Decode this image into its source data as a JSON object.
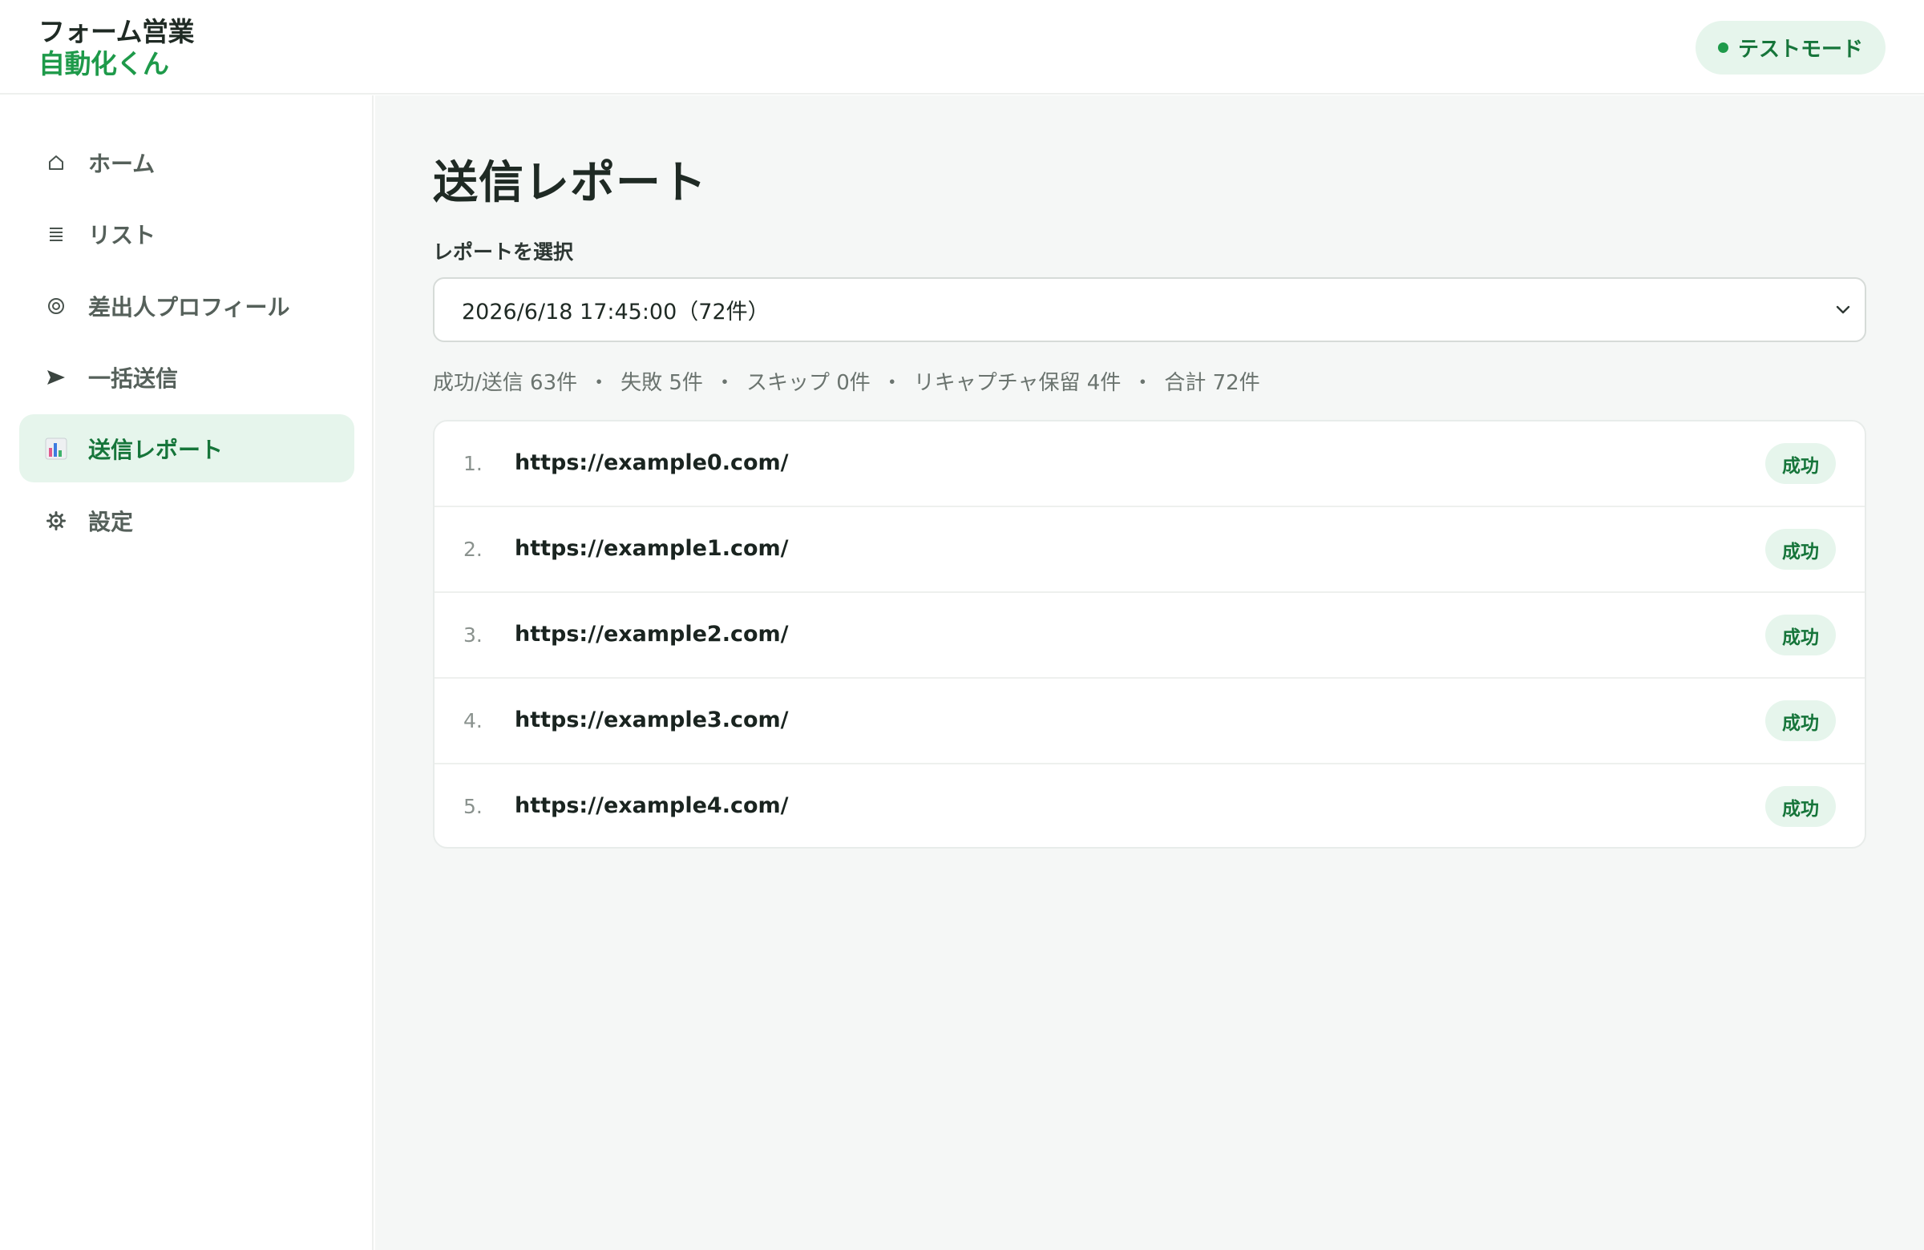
{
  "header": {
    "logo_line1": "フォーム営業",
    "logo_line2": "自動化くん",
    "mode_badge": "テストモード"
  },
  "sidebar": {
    "items": [
      {
        "label": "ホーム",
        "icon": "home-icon"
      },
      {
        "label": "リスト",
        "icon": "list-icon"
      },
      {
        "label": "差出人プロフィール",
        "icon": "profile-icon"
      },
      {
        "label": "一括送信",
        "icon": "send-icon"
      },
      {
        "label": "送信レポート",
        "icon": "chart-icon",
        "active": true
      },
      {
        "label": "設定",
        "icon": "gear-icon"
      }
    ]
  },
  "main": {
    "title": "送信レポート",
    "select_label": "レポートを選択",
    "selected_report": "2026/6/18 17:45:00（72件）",
    "summary": {
      "sent": "成功/送信 63件",
      "failed": "失敗 5件",
      "skipped": "スキップ 0件",
      "recaptcha": "リキャプチャ保留 4件",
      "total": "合計 72件",
      "separator": "・"
    },
    "results": [
      {
        "num": "1.",
        "url": "https://example0.com/",
        "status": "成功"
      },
      {
        "num": "2.",
        "url": "https://example1.com/",
        "status": "成功"
      },
      {
        "num": "3.",
        "url": "https://example2.com/",
        "status": "成功"
      },
      {
        "num": "4.",
        "url": "https://example3.com/",
        "status": "成功"
      },
      {
        "num": "5.",
        "url": "https://example4.com/",
        "status": "成功"
      }
    ]
  },
  "colors": {
    "accent": "#1e9a4a",
    "accent_bg": "#e6f5ec",
    "main_bg": "#f5f7f6"
  }
}
